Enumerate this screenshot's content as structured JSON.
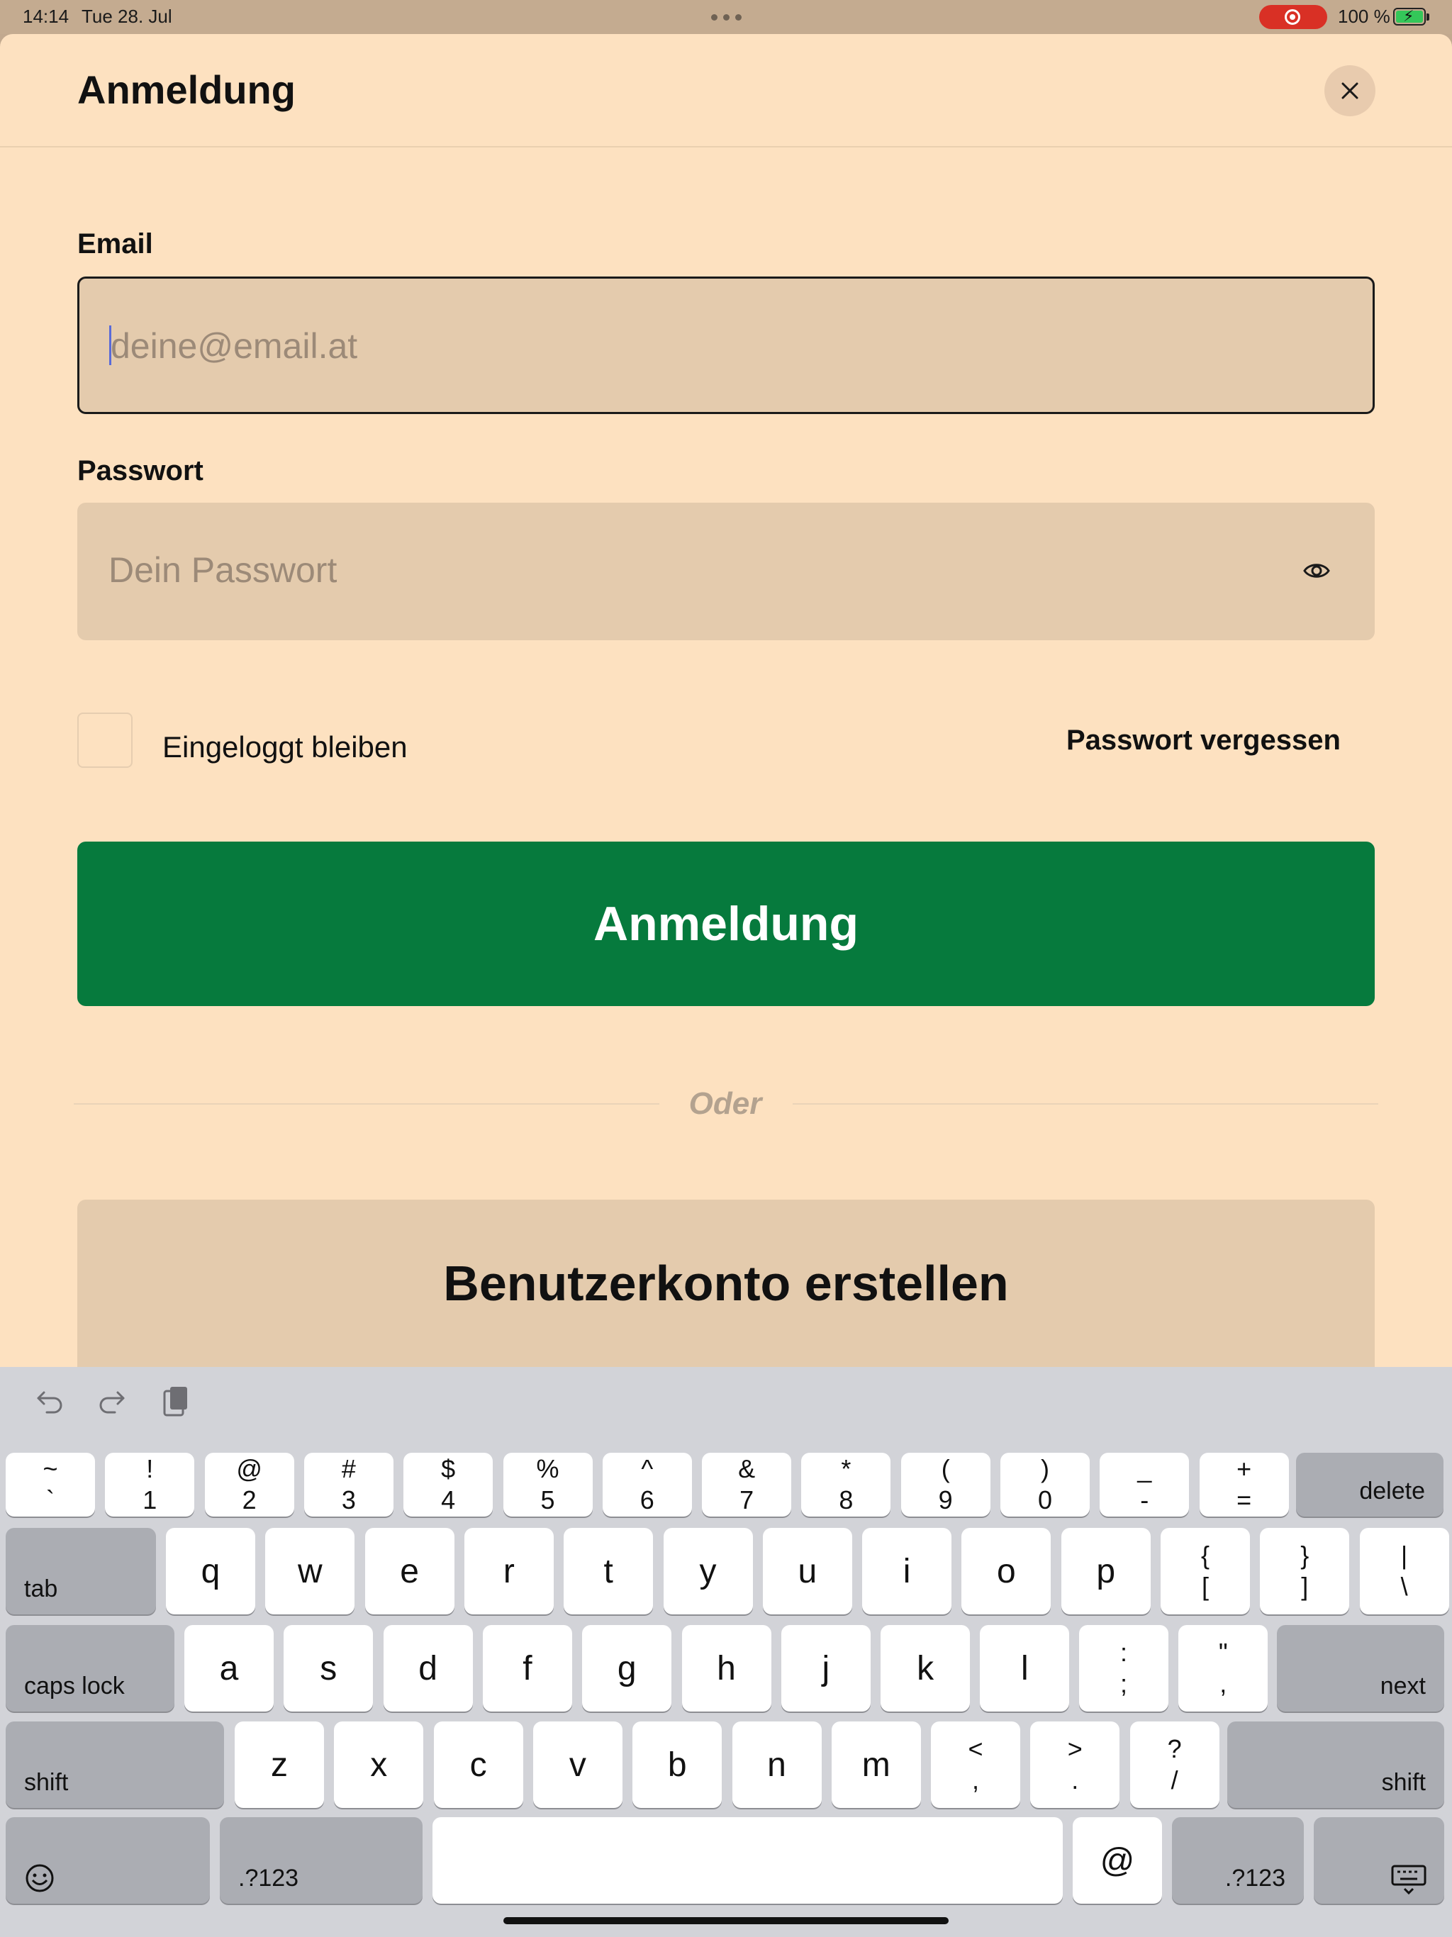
{
  "status_bar": {
    "time": "14:14",
    "date": "Tue 28. Jul",
    "battery": "100 %"
  },
  "header": {
    "title": "Anmeldung"
  },
  "form": {
    "email_label": "Email",
    "email_placeholder": "deine@email.at",
    "password_label": "Passwort",
    "password_placeholder": "Dein Passwort",
    "remember_label": "Eingeloggt bleiben",
    "forgot_label": "Passwort vergessen",
    "submit_label": "Anmeldung",
    "divider_label": "Oder",
    "register_label": "Benutzerkonto erstellen"
  },
  "keyboard": {
    "number_row": [
      {
        "top": "~",
        "bottom": "`"
      },
      {
        "top": "!",
        "bottom": "1"
      },
      {
        "top": "@",
        "bottom": "2"
      },
      {
        "top": "#",
        "bottom": "3"
      },
      {
        "top": "$",
        "bottom": "4"
      },
      {
        "top": "%",
        "bottom": "5"
      },
      {
        "top": "^",
        "bottom": "6"
      },
      {
        "top": "&",
        "bottom": "7"
      },
      {
        "top": "*",
        "bottom": "8"
      },
      {
        "top": "(",
        "bottom": "9"
      },
      {
        "top": ")",
        "bottom": "0"
      },
      {
        "top": "_",
        "bottom": "-"
      },
      {
        "top": "+",
        "bottom": "="
      }
    ],
    "delete": "delete",
    "tab": "tab",
    "row_q": [
      "q",
      "w",
      "e",
      "r",
      "t",
      "y",
      "u",
      "i",
      "o",
      "p"
    ],
    "row_q_extra": [
      {
        "top": "{",
        "bottom": "["
      },
      {
        "top": "}",
        "bottom": "]"
      },
      {
        "top": "|",
        "bottom": "\\"
      }
    ],
    "caps_lock": "caps lock",
    "row_a": [
      "a",
      "s",
      "d",
      "f",
      "g",
      "h",
      "j",
      "k",
      "l"
    ],
    "row_a_extra": [
      {
        "top": ":",
        "bottom": ";"
      },
      {
        "top": "\"",
        "bottom": ","
      }
    ],
    "next": "next",
    "shift": "shift",
    "row_z": [
      "z",
      "x",
      "c",
      "v",
      "b",
      "n",
      "m"
    ],
    "row_z_extra": [
      {
        "top": "<",
        "bottom": ","
      },
      {
        "top": ">",
        "bottom": "."
      },
      {
        "top": "?",
        "bottom": "/"
      }
    ],
    "numbers_toggle": ".?123",
    "at": "@",
    "emoji_icon": "emoji-icon",
    "hide_keyboard_icon": "keyboard-hide-icon"
  },
  "colors": {
    "sheet_bg": "#fde1c0",
    "field_bg": "#e4cbad",
    "primary": "#067a3d",
    "keyboard_bg": "#d2d3d8"
  }
}
